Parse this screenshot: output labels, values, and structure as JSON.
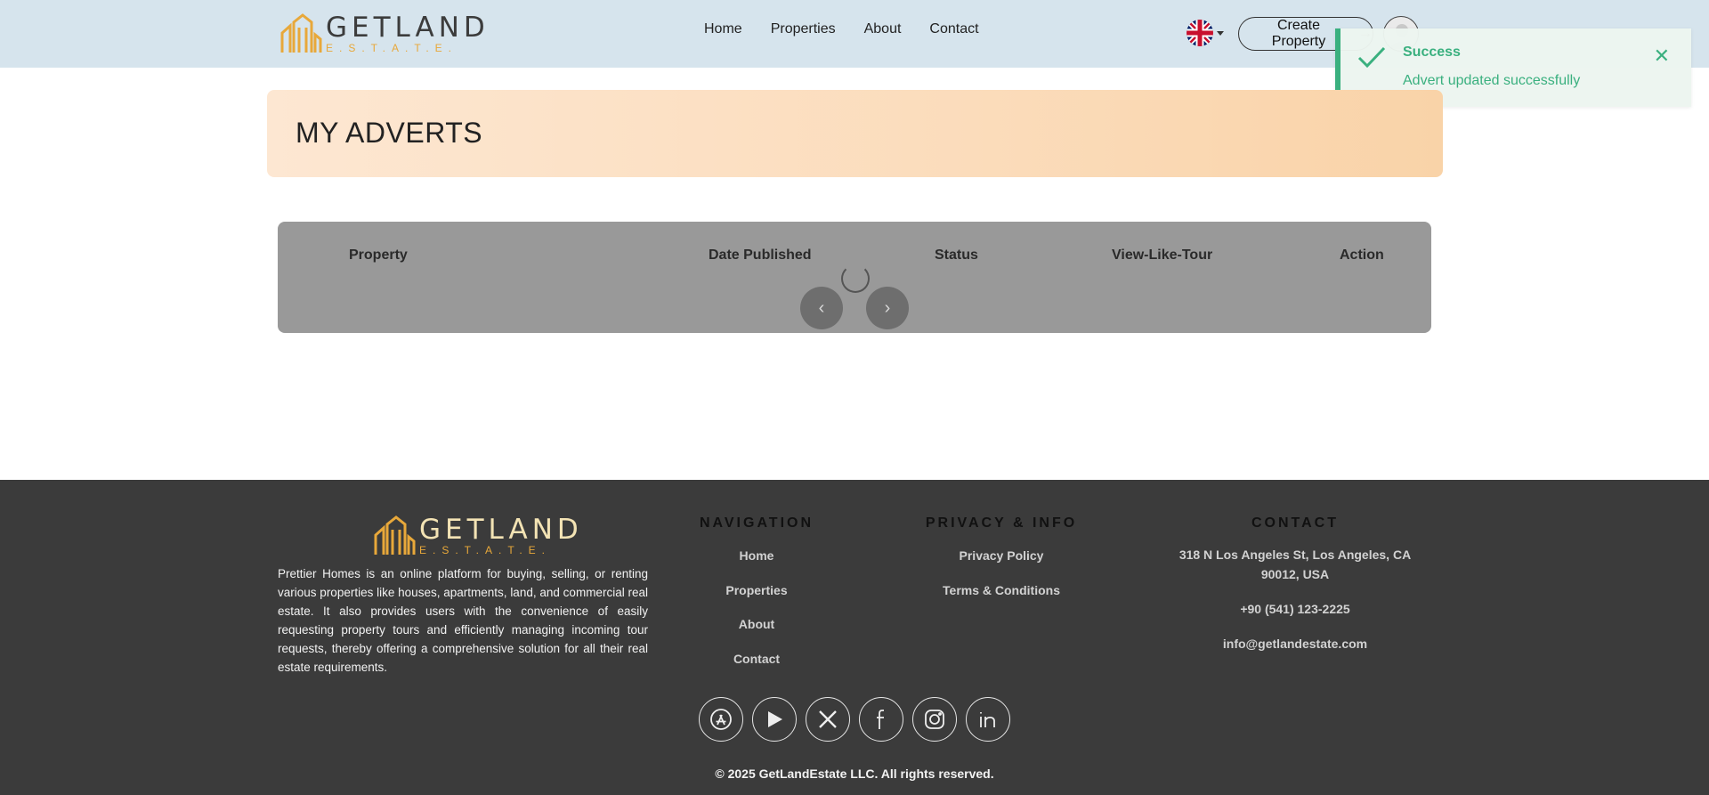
{
  "header": {
    "logo": {
      "main": "GETLAND",
      "sub": "E.S.T.A.T.E."
    },
    "nav": [
      "Home",
      "Properties",
      "About",
      "Contact"
    ],
    "create_label": "Create Property",
    "language_icon": "uk-flag-icon"
  },
  "toast": {
    "title": "Success",
    "message": "Advert updated successfully",
    "icon": "check-icon",
    "accent": "#3ab07f"
  },
  "banner": {
    "title": "MY ADVERTS"
  },
  "table": {
    "columns": [
      "Property",
      "Date Published",
      "Status",
      "View-Like-Tour",
      "Action"
    ],
    "rows": [],
    "prev_label": "‹",
    "next_label": "›"
  },
  "footer": {
    "logo": {
      "main": "GETLAND",
      "sub": "E.S.T.A.T.E."
    },
    "description": "Prettier Homes is an online platform for buying, selling, or renting various properties like houses, apartments, land, and commercial real estate. It also provides users with the convenience of easily requesting property tours and efficiently managing incoming tour requests, thereby offering a comprehensive solution for all their real estate requirements.",
    "navigation": {
      "title": "NAVIGATION",
      "links": [
        "Home",
        "Properties",
        "About",
        "Contact"
      ]
    },
    "privacy": {
      "title": "PRIVACY & INFO",
      "links": [
        "Privacy Policy",
        "Terms & Conditions"
      ]
    },
    "contact": {
      "title": "CONTACT",
      "address": "318 N Los Angeles St, Los Angeles, CA 90012, USA",
      "phone": "+90 (541) 123-2225",
      "email": "info@getlandestate.com"
    },
    "socials": [
      "app-store-icon",
      "play-store-icon",
      "x-icon",
      "facebook-icon",
      "instagram-icon",
      "linkedin-icon"
    ],
    "copyright": "© 2025 GetLandEstate LLC. All rights reserved."
  },
  "colors": {
    "header_bg": "#d6e4ed",
    "banner_start": "#fde7d2",
    "banner_end": "#f9d3a8",
    "table_bg": "#999999",
    "footer_bg": "#3b3b3b",
    "logo_gold": "#e8a83a"
  }
}
